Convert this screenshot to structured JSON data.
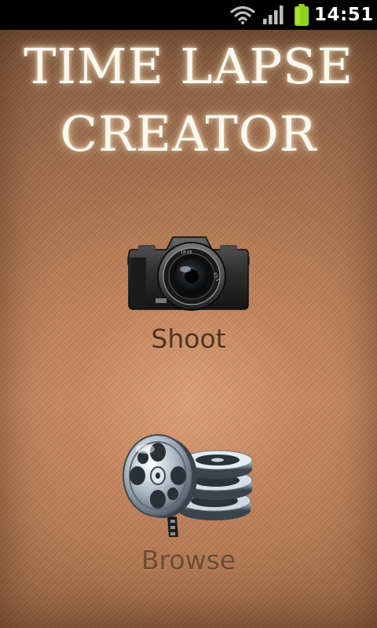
{
  "status_bar": {
    "time": "14:51",
    "icons": [
      "wifi-icon",
      "signal-icon",
      "battery-icon"
    ],
    "battery_color": "#8ed21c"
  },
  "app": {
    "title_line1": "TIME LAPSE",
    "title_line2": "CREATOR"
  },
  "menu": {
    "shoot_label": "Shoot",
    "shoot_icon": "camera-icon",
    "browse_label": "Browse",
    "browse_icon": "film-reels-icon"
  },
  "colors": {
    "title_text": "#fdf8ef",
    "shoot_label": "#4d3322",
    "browse_label": "#6a4c33",
    "background_center": "#de9f76",
    "background_edge": "#7f583c"
  }
}
